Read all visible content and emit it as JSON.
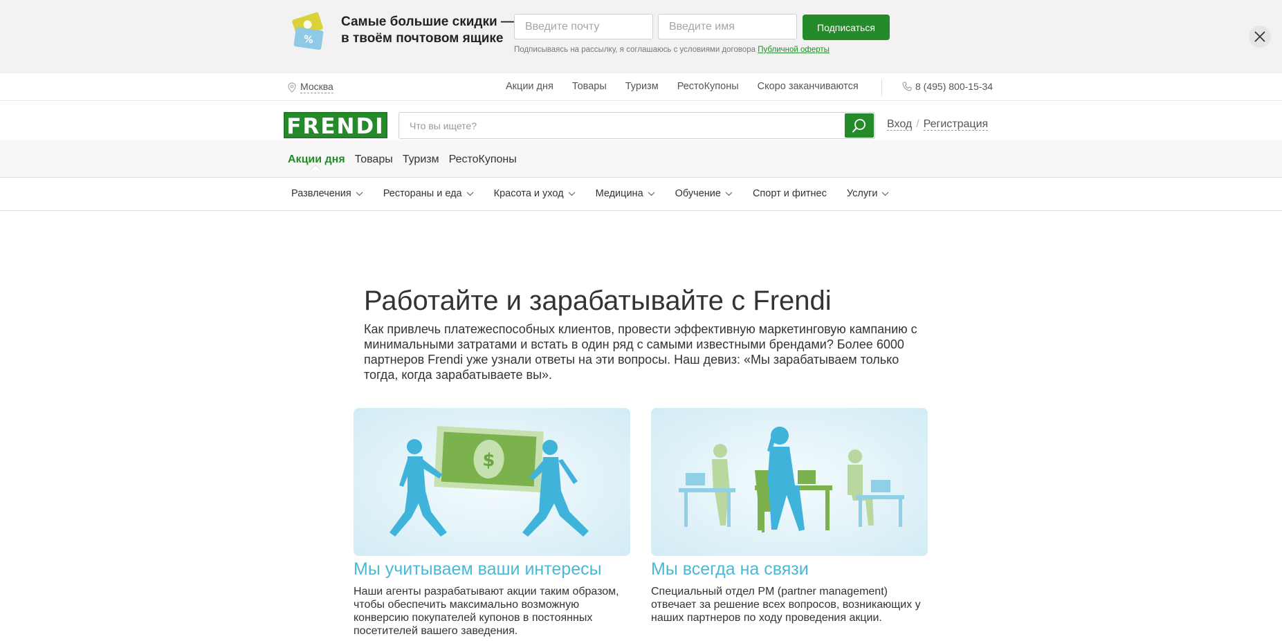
{
  "promo": {
    "title_line1": "Самые большие скидки —",
    "title_line2": "в твоём почтовом ящике",
    "email_placeholder": "Введите почту",
    "name_placeholder": "Введите имя",
    "subscribe_label": "Подписаться",
    "consent_text": "Подписываясь на рассылку, я соглашаюсь с условиями договора ",
    "consent_link": "Публичной оферты"
  },
  "topline": {
    "city": "Москва",
    "nav": [
      "Акции дня",
      "Товары",
      "Туризм",
      "РестоКупоны",
      "Скоро заканчиваются"
    ],
    "phone": "8 (495) 800-15-34"
  },
  "header": {
    "logo": "FRENDI",
    "search_placeholder": "Что вы ищете?",
    "login": "Вход",
    "separator": "/",
    "register": "Регистрация"
  },
  "category_tabs": [
    "Акции дня",
    "Товары",
    "Туризм",
    "РестоКупоны"
  ],
  "subnav": [
    "Развлечения",
    "Рестораны и еда",
    "Красота и уход",
    "Медицина",
    "Обучение",
    "Спорт и фитнес",
    "Услуги"
  ],
  "main": {
    "title": "Работайте и зарабатывайте с Frendi",
    "description": "Как привлечь платежеспособных клиентов, провести эффективную маркетинговую кампанию с минимальными затратами и встать в один ряд с самыми известными брендами? Более 6000 партнеров Frendi уже узнали ответы на эти вопросы. Наш девиз: «Мы зарабатываем только тогда, когда зарабатываете вы».",
    "cards": [
      {
        "title": "Мы учитываем ваши интересы",
        "text": "Наши агенты разрабатывают акции таким образом, чтобы обеспечить максимально возможную конверсию покупателей купонов в постоянных посетителей вашего заведения."
      },
      {
        "title": "Мы всегда на связи",
        "text": "Специальный отдел PM (partner management) отвечает за решение всех вопросов, возникающих у наших партнеров по ходу проведения акции."
      }
    ]
  },
  "colors": {
    "brand_green": "#248a2a",
    "accent_blue": "#4bb8d4",
    "banner_bg": "#f2f2f2"
  },
  "icons": {
    "promo": "coupon-percent-icon",
    "close": "close-icon",
    "location": "location-pin-icon",
    "phone": "phone-icon",
    "search": "search-icon",
    "chevron": "chevron-down-icon"
  }
}
